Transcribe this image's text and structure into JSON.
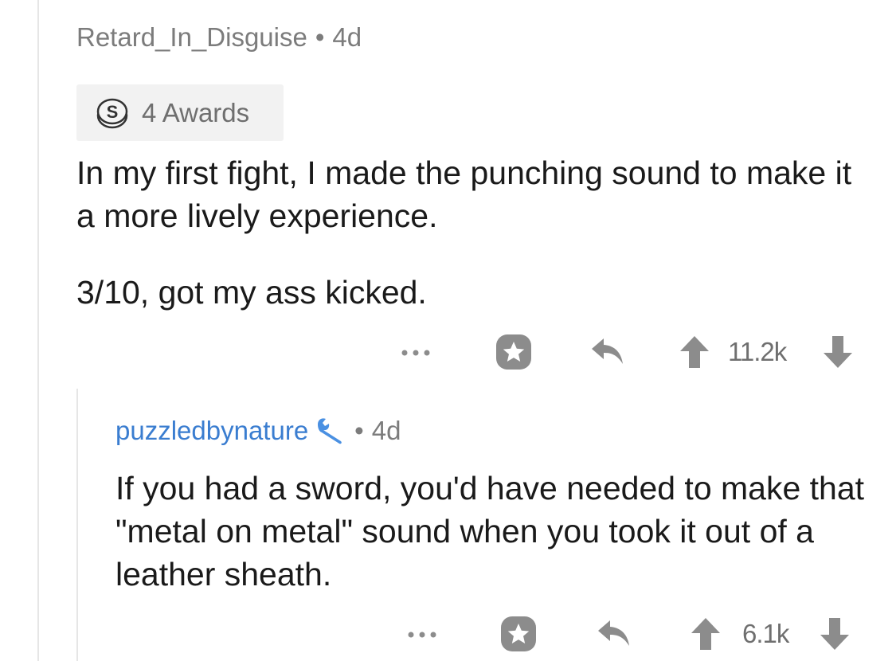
{
  "comment": {
    "username": "Retard_In_Disguise",
    "separator": "•",
    "age": "4d",
    "awards_label": "4 Awards",
    "awards_icon": "silver-award-icon",
    "body": [
      "In my first fight, I made the punching sound to make it a more lively experience.",
      "3/10, got my ass kicked."
    ],
    "actions": {
      "more": "•••",
      "score": "11.2k"
    }
  },
  "reply": {
    "username": "puzzledbynature",
    "flair_icon": "wrench-flair-icon",
    "separator": "•",
    "age": "4d",
    "body": [
      "If you had a sword, you'd have needed to make that \"metal on metal\" sound when you took it out of a leather sheath."
    ],
    "actions": {
      "more": "•••",
      "score": "6.1k"
    }
  },
  "colors": {
    "text": "#1a1a1a",
    "meta": "#7c7c7c",
    "op_username": "#3a7dd0",
    "icons": "#8c8c8c",
    "thread_line": "#e6e6e6"
  }
}
